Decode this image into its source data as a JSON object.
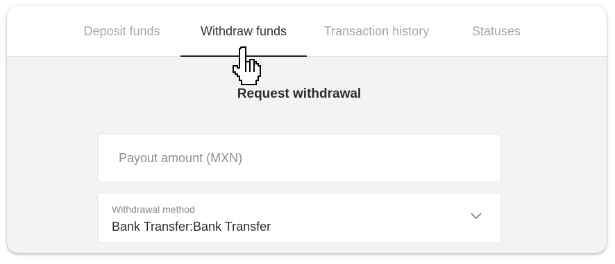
{
  "tabs": [
    {
      "label": "Deposit funds",
      "active": false
    },
    {
      "label": "Withdraw funds",
      "active": true
    },
    {
      "label": "Transaction history",
      "active": false
    },
    {
      "label": "Statuses",
      "active": false
    }
  ],
  "main": {
    "title": "Request withdrawal"
  },
  "amount_field": {
    "placeholder": "Payout amount (MXN)",
    "value": ""
  },
  "method_field": {
    "label": "Withdrawal method",
    "value": "Bank Transfer:Bank Transfer",
    "icon": "chevron-down-icon"
  },
  "cursor": {
    "icon": "hand-pointer-cursor-icon"
  },
  "colors": {
    "background": "#f3f3f3",
    "active_tab": "#333333",
    "inactive_tab": "#a6a6a6",
    "underline": "#222222"
  }
}
